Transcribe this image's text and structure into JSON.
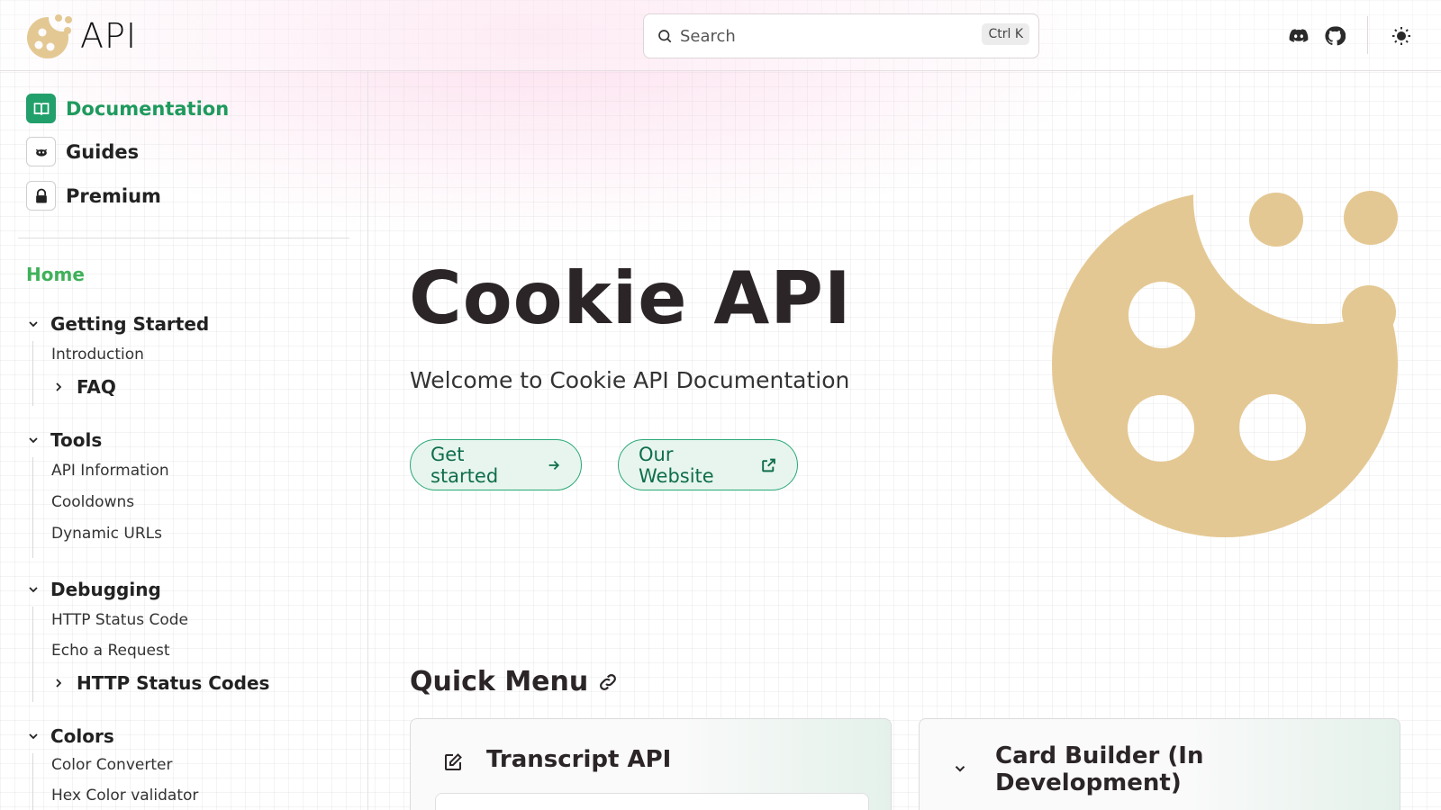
{
  "header": {
    "logo_text": "API",
    "search_placeholder": "Search",
    "search_shortcut": "Ctrl K",
    "icons": [
      "discord-icon",
      "github-icon",
      "theme-toggle-icon"
    ]
  },
  "sidebar": {
    "top_links": [
      {
        "label": "Documentation",
        "icon": "book-icon",
        "active": true
      },
      {
        "label": "Guides",
        "icon": "guide-icon",
        "active": false
      },
      {
        "label": "Premium",
        "icon": "lock-icon",
        "active": false
      }
    ],
    "home": "Home",
    "sections": [
      {
        "title": "Getting Started",
        "items": [
          "Introduction"
        ],
        "groups": [
          "FAQ"
        ]
      },
      {
        "title": "Tools",
        "items": [
          "API Information",
          "Cooldowns",
          "Dynamic URLs"
        ]
      },
      {
        "title": "Debugging",
        "items": [
          "HTTP Status Code",
          "Echo a Request"
        ],
        "groups": [
          "HTTP Status Codes"
        ]
      },
      {
        "title": "Colors",
        "items": [
          "Color Converter",
          "Hex Color validator"
        ]
      }
    ]
  },
  "main": {
    "title": "Cookie API",
    "tagline": "Welcome to Cookie API Documentation",
    "buttons": {
      "get_started": "Get started",
      "website": "Our Website"
    },
    "quick_menu": "Quick Menu",
    "cards": [
      {
        "title": "Transcript API",
        "icon": "edit-icon"
      },
      {
        "title": "Card Builder (In Development)",
        "icon": "chevron-down-icon"
      }
    ]
  },
  "colors": {
    "accent": "#1f9a5e",
    "cookie": "#e4c893"
  }
}
